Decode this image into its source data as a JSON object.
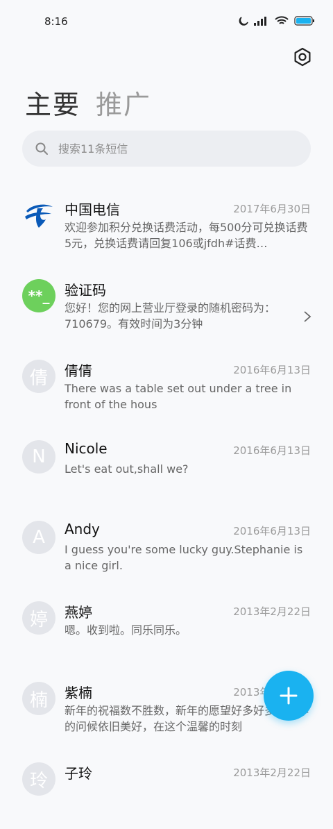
{
  "status_bar": {
    "time": "8:16"
  },
  "tabs": [
    {
      "label": "主要"
    },
    {
      "label": "推广"
    }
  ],
  "search": {
    "placeholder": "搜索11条短信"
  },
  "conversations": [
    {
      "name": "中国电信",
      "date": "2017年6月30日",
      "preview": "欢迎参加积分兑换话费活动，每500分可兑换话费5元，兑换话费请回复106或jfdh#话费…",
      "avatar_type": "logo"
    },
    {
      "name": "验证码",
      "date": "",
      "preview": "您好！您的网上营业厅登录的随机密码为：710679。有效时间为3分钟",
      "avatar_text": "**_"
    },
    {
      "name": "倩倩",
      "date": "2016年6月13日",
      "preview": "There was a table set out under a tree in front of the hous",
      "avatar_text": "倩"
    },
    {
      "name": "Nicole",
      "date": "2016年6月13日",
      "preview": "Let's eat out,shall we?",
      "avatar_text": "N"
    },
    {
      "name": "Andy",
      "date": "2016年6月13日",
      "preview": "I guess you're some lucky guy.Stephanie is a nice girl.",
      "avatar_text": "A"
    },
    {
      "name": "燕婷",
      "date": "2013年2月22日",
      "preview": "嗯。收到啦。同乐同乐。",
      "avatar_text": "婷"
    },
    {
      "name": "紫楠",
      "date": "2013年2月22日",
      "preview": "新年的祝福数不胜数，新年的愿望好多好多，新年的问候依旧美好，在这个温馨的时刻",
      "avatar_text": "楠"
    },
    {
      "name": "子玲",
      "date": "2013年2月22日",
      "preview": "",
      "avatar_text": "玲"
    }
  ],
  "colors": {
    "fab": "#1ab2f0",
    "verify_avatar": "#6dd05c",
    "telecom_blue": "#0a5ab8"
  },
  "icons": {
    "settings": "settings-icon",
    "search": "search-icon",
    "fab": "plus-icon",
    "chevron": "chevron-right-icon"
  }
}
